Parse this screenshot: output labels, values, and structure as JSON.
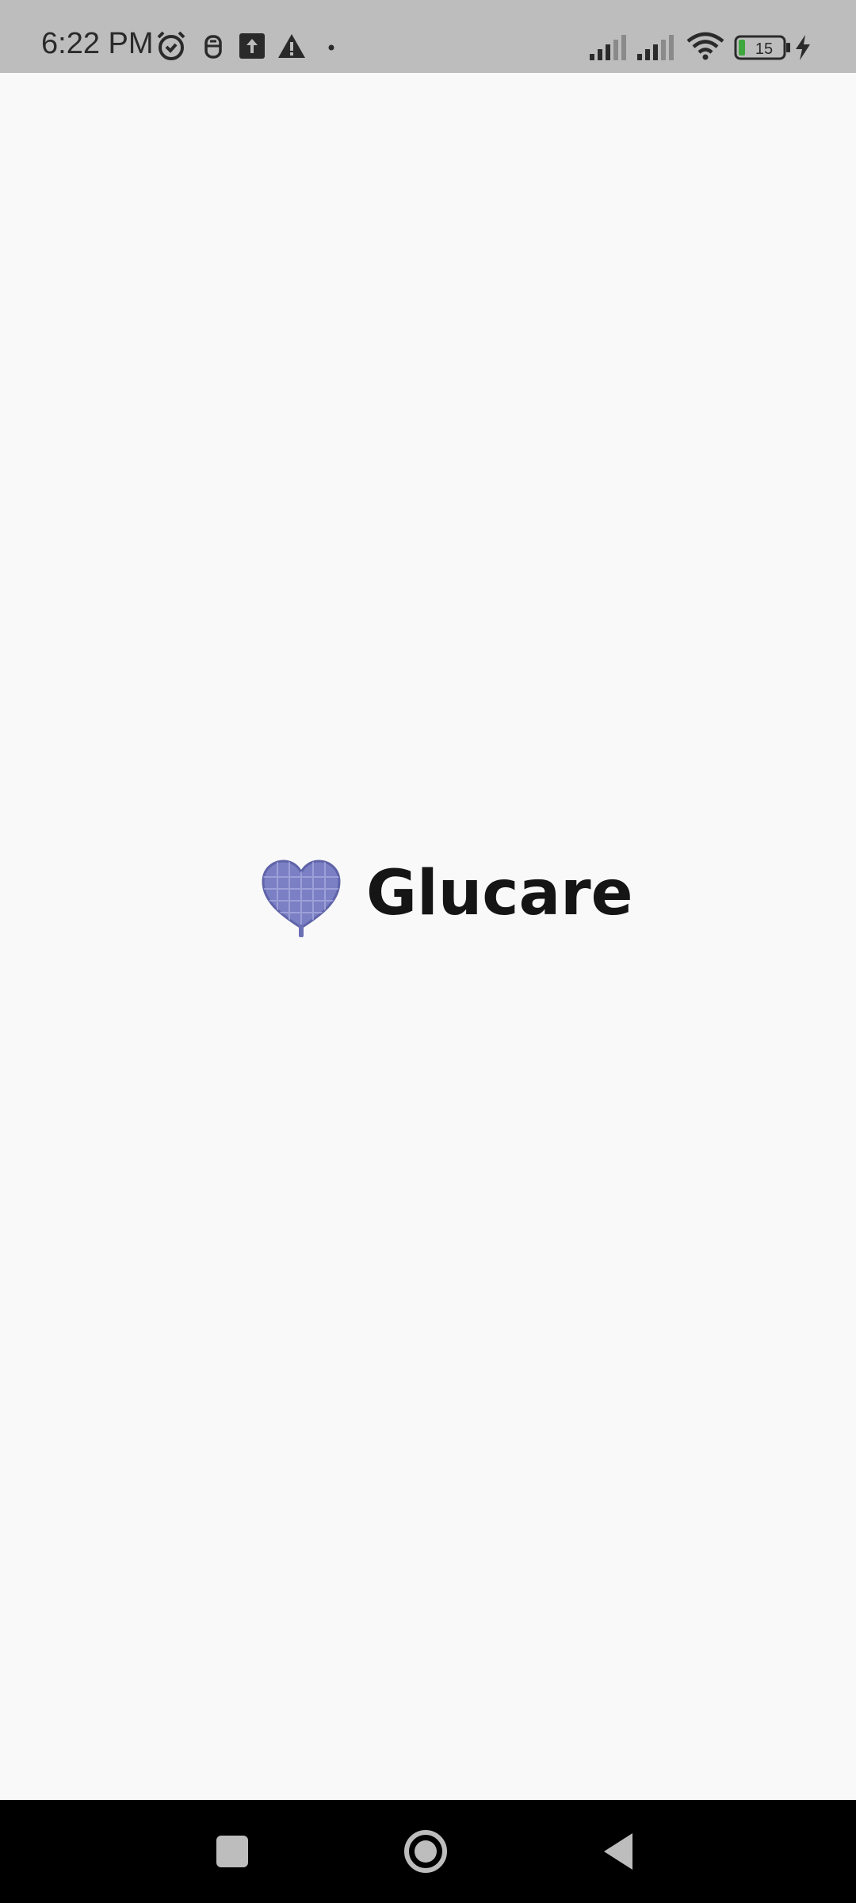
{
  "status_bar": {
    "time": "6:22 PM",
    "battery_level": "15",
    "icons": [
      "alarm-icon",
      "notification-app-icon",
      "upload-icon",
      "warning-icon",
      "dot-icon",
      "signal-icon",
      "signal-icon",
      "wifi-icon",
      "battery-icon",
      "charging-icon"
    ]
  },
  "splash": {
    "app_name": "Glucare",
    "logo_icon": "heart-logo-icon",
    "brand_color": "#7b7fc4"
  },
  "nav_bar": {
    "buttons": [
      "recents-button",
      "home-button",
      "back-button"
    ]
  },
  "colors": {
    "background": "#f9f9f9",
    "status_bar": "#bdbdbd",
    "nav_bar": "#000000",
    "text": "#151515"
  }
}
